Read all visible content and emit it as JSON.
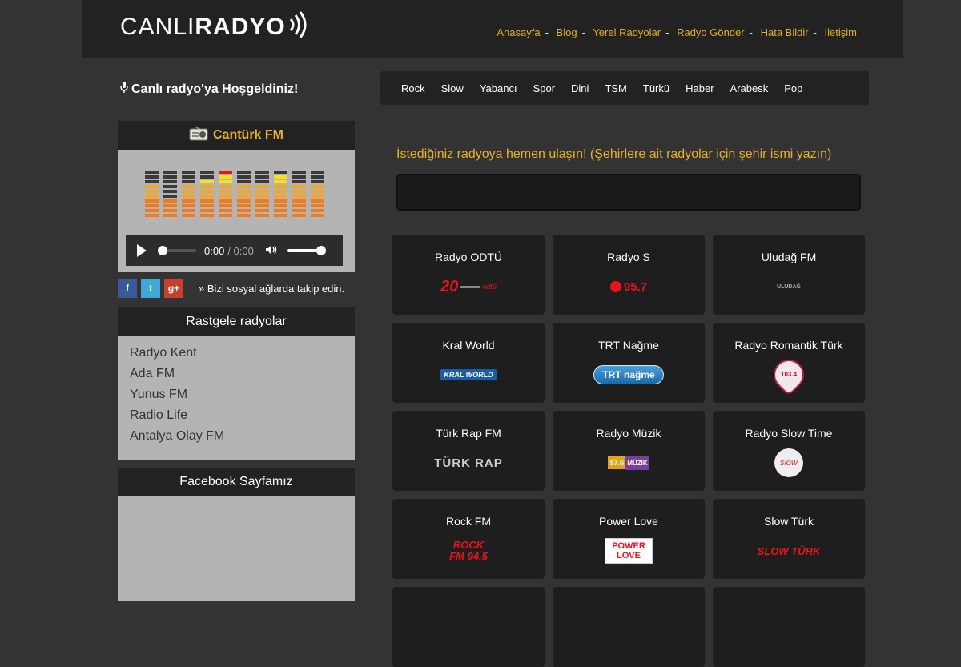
{
  "logo": {
    "part1": "CANLI",
    "part2": "RADYO"
  },
  "nav": [
    "Anasayfa",
    "Blog",
    "Yerel Radyolar",
    "Radyo Gönder",
    "Hata Bildir",
    "İletişim"
  ],
  "welcome": "Canlı radyo'ya Hoşgeldiniz!",
  "genres": [
    "Rock",
    "Slow",
    "Yabancı",
    "Spor",
    "Dini",
    "TSM",
    "Türkü",
    "Haber",
    "Arabesk",
    "Pop"
  ],
  "player": {
    "station": "Cantürk FM",
    "current_time": "0:00",
    "duration": "/ 0:00",
    "volume": 1.0
  },
  "social_text": "Bizi sosyal ağlarda takip edin.",
  "random": {
    "title": "Rastgele radyolar",
    "items": [
      "Radyo Kent",
      "Ada FM",
      "Yunus FM",
      "Radio Life",
      "Antalya Olay FM"
    ]
  },
  "facebook_title": "Facebook Sayfamız",
  "search": {
    "label": "İstediğiniz radyoya hemen ulaşın! (Şehirlere ait radyolar için şehir ismi yazın)",
    "value": ""
  },
  "stations": [
    {
      "name": "Radyo ODTÜ",
      "logo": "Radyo ODTÜ logo: 20 odtü",
      "logo_text": "20"
    },
    {
      "name": "Radyo S",
      "logo": "Radyo S logo: 95.7",
      "logo_text": "95.7"
    },
    {
      "name": "Uludağ FM",
      "logo": "Uludağ FM logo",
      "logo_text": "ULUDAĞ"
    },
    {
      "name": "Kral World",
      "logo": "Kral World logo",
      "logo_text": "KRAL WORLD"
    },
    {
      "name": "TRT Nağme",
      "logo": "TRT Nağme logo",
      "logo_text": "TRT nağme"
    },
    {
      "name": "Radyo Romantik Türk",
      "logo": "Romantik Türk logo: 103.4",
      "logo_text": "103.4"
    },
    {
      "name": "Türk Rap FM",
      "logo": "Türk Rap logo",
      "logo_text": "TÜRK RAP"
    },
    {
      "name": "Radyo Müzik",
      "logo": "Radyo Müzik logo: 97.6",
      "logo_text": "97.6"
    },
    {
      "name": "Radyo Slow Time",
      "logo": "Slow Time logo",
      "logo_text": "slow"
    },
    {
      "name": "Rock FM",
      "logo": "Rock FM logo: 94.5",
      "logo_text": "ROCK FM 94.5"
    },
    {
      "name": "Power Love",
      "logo": "Power Love logo",
      "logo_text": "POWER LOVE"
    },
    {
      "name": "Slow Türk",
      "logo": "Slow Türk logo",
      "logo_text": "SLOW TÜRK"
    }
  ],
  "colors": {
    "accent": "#e8b028",
    "header_bg": "#222222",
    "page_bg": "#333333",
    "panel_bg": "#b4b4b4",
    "card_bg": "#1e1e1e"
  }
}
